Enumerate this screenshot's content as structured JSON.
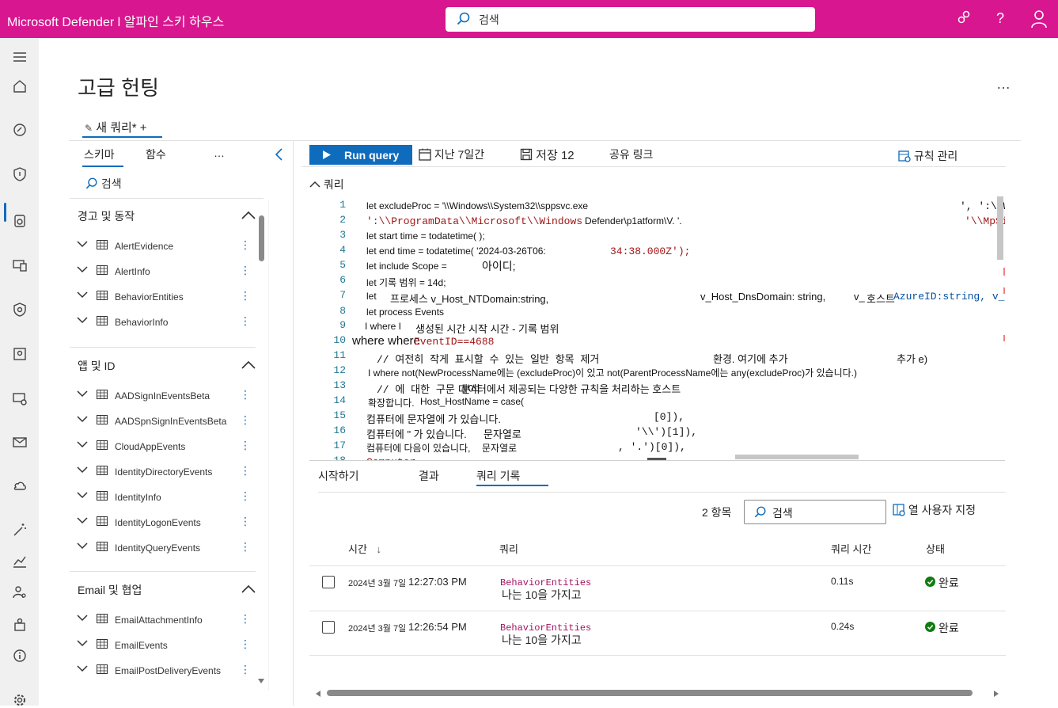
{
  "header": {
    "title": "Microsoft Defender l 알파인 스키 하우스",
    "search_placeholder": "검색"
  },
  "page": {
    "title": "고급 헌팅",
    "more": "…",
    "query_tab": "새 쿼리* +"
  },
  "left": {
    "tabs": [
      "스키마",
      "함수",
      "…"
    ],
    "search": "검색",
    "sections": [
      {
        "title": "경고 및 동작",
        "tables": [
          "AlertEvidence",
          "AlertInfo",
          "BehaviorEntities",
          "BehaviorInfo"
        ]
      },
      {
        "title": "앱 및 ID",
        "tables": [
          "AADSignInEventsBeta",
          "AADSpnSignInEventsBeta",
          "CloudAppEvents",
          "IdentityDirectoryEvents",
          "IdentityInfo",
          "IdentityLogonEvents",
          "IdentityQueryEvents"
        ]
      },
      {
        "title": "Email 및 협업",
        "tables": [
          "EmailAttachmentInfo",
          "EmailEvents",
          "EmailPostDeliveryEvents"
        ]
      }
    ]
  },
  "toolbar": {
    "run": "Run query",
    "range": "지난 7일간",
    "save": "저장 12",
    "share": "공유 링크",
    "rules": "규칙 관리"
  },
  "editor": {
    "label": "쿼리",
    "lines": [
      {
        "n": "1",
        "parts": [
          "let excludeProc = '\\\\Windows\\\\System32\\\\sppsvc.exe",
          "', ':\\\\W"
        ]
      },
      {
        "n": "2",
        "parts": [
          "':\\\\ProgramData\\\\Microsoft\\\\Windows",
          "Defender\\p1atform\\V. '.",
          "'\\\\MpSi"
        ]
      },
      {
        "n": "3",
        "parts": [
          "let start time = todatetime( );"
        ]
      },
      {
        "n": "4",
        "parts": [
          "let end time = todatetime( '2024-03-26T06:",
          "34:38.000Z');"
        ]
      },
      {
        "n": "5",
        "parts": [
          "let include Scope =",
          "아이디;"
        ]
      },
      {
        "n": "6",
        "parts": [
          "let 기록 범위 = 14d;"
        ]
      },
      {
        "n": "7",
        "parts": [
          "let",
          "프로세스 v_Host_NTDomain:string,",
          "v_Host_DnsDomain: string,",
          "v_",
          "호스트",
          "AzureID:string, v_"
        ]
      },
      {
        "n": "8",
        "parts": [
          "let process Events"
        ]
      },
      {
        "n": "9",
        "parts": [
          "I where I",
          "생성된 시간 시작 시간 - 기록 범위"
        ]
      },
      {
        "n": "10",
        "parts": [
          "where where",
          "EventID==4688"
        ]
      },
      {
        "n": "11",
        "parts": [
          "// 여전히 작게 표시할 수 있는 일반 항목 제거",
          "환경. 여기에 추가",
          "추가 e)"
        ]
      },
      {
        "n": "12",
        "parts": [
          "I where not(NewProcessName에는 (excludeProc)이 있고 not(ParentProcessName에는 any(excludeProc)가 있습니다.)"
        ]
      },
      {
        "n": "13",
        "parts": [
          "// 에 대한 구문 분석",
          "데이터에서 제공되는 다양한 규칙을 처리하는 호스트"
        ]
      },
      {
        "n": "14",
        "parts": [
          "확장합니다.",
          "Host_HostName = case("
        ]
      },
      {
        "n": "15",
        "parts": [
          "컴퓨터에 문자열에 가 있습니다.",
          "[0]),"
        ]
      },
      {
        "n": "16",
        "parts": [
          "컴퓨터에 \" 가 있습니다.",
          "문자열로",
          "'\\\\')[1]),"
        ]
      },
      {
        "n": "17",
        "parts": [
          "컴퓨터에 다음이 있습니다,",
          "문자열로",
          ", '.')[0]),"
        ]
      },
      {
        "n": "18",
        "parts": [
          "Computer"
        ]
      }
    ]
  },
  "results": {
    "tabs": [
      "시작하기",
      "결과",
      "쿼리 기록"
    ],
    "count": "2 항목",
    "search": "검색",
    "customize": "열 사용자 지정",
    "columns": [
      "시간",
      "쿼리",
      "쿼리 시간",
      "상태"
    ],
    "rows": [
      {
        "date": "2024년 3월 7일",
        "time": "12:27:03 PM",
        "q1": "BehaviorEntities",
        "q2": "나는 10을 가지고",
        "dur": "0.11s",
        "status": "완료"
      },
      {
        "date": "2024년 3월 7일",
        "time": "12:26:54 PM",
        "q1": "BehaviorEntities",
        "q2": "나는 10을 가지고",
        "dur": "0.24s",
        "status": "완료"
      }
    ]
  }
}
